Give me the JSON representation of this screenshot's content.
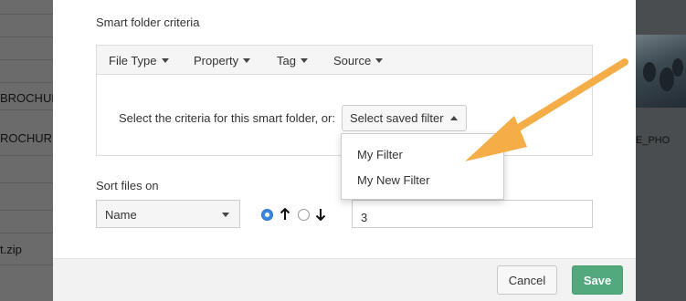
{
  "background": {
    "left_items": [
      "BROCHUR",
      "ROCHUR",
      "t.zip"
    ],
    "right_label": "E_PHO"
  },
  "dialog": {
    "criteria_label": "Smart folder criteria",
    "criteria_tabs": [
      {
        "label": "File Type",
        "icon": "chevron-down-icon"
      },
      {
        "label": "Property",
        "icon": "chevron-down-icon"
      },
      {
        "label": "Tag",
        "icon": "chevron-down-icon"
      },
      {
        "label": "Source",
        "icon": "chevron-down-icon"
      }
    ],
    "criteria_prompt": "Select the criteria for this smart folder, or:",
    "saved_filter_button": "Select saved filter",
    "saved_filter_menu": [
      "My Filter",
      "My New Filter"
    ],
    "sort_label": "Sort files on",
    "sort_field_value": "Name",
    "sort_direction": {
      "ascending_selected": true,
      "ascending_icon": "arrow-up-icon",
      "descending_icon": "arrow-down-icon"
    },
    "number_value": "3",
    "cancel_label": "Cancel",
    "save_label": "Save"
  },
  "colors": {
    "accent_blue": "#3a87e0",
    "save_green": "#52a97d",
    "annotation_orange": "#f5ad47"
  }
}
